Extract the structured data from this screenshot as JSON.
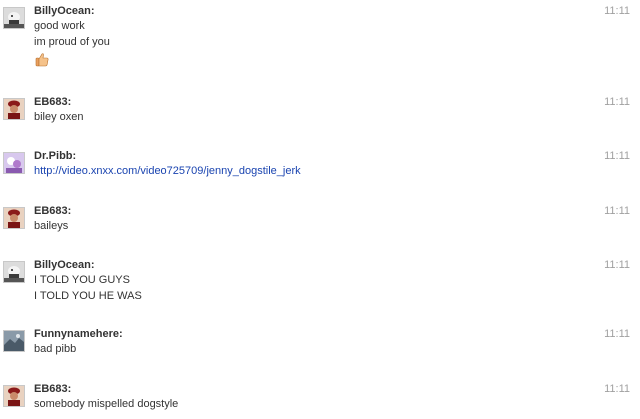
{
  "messages": [
    {
      "sender": "BillyOcean:",
      "time": "11:11",
      "avatar": "billyocean-avatar",
      "lines": [
        "good work",
        "im proud of you"
      ],
      "emoticon": "thumbs-up-icon"
    },
    {
      "sender": "EB683:",
      "time": "11:11",
      "avatar": "eb683-avatar",
      "lines": [
        "biley oxen"
      ]
    },
    {
      "sender": "Dr.Pibb:",
      "time": "11:11",
      "avatar": "drpibb-avatar",
      "lines": [
        "http://video.xnxx.com/video725709/jenny_dogstile_jerk"
      ],
      "link": true
    },
    {
      "sender": "EB683:",
      "time": "11:11",
      "avatar": "eb683-avatar",
      "lines": [
        "baileys"
      ]
    },
    {
      "sender": "BillyOcean:",
      "time": "11:11",
      "avatar": "billyocean-avatar",
      "lines": [
        "I TOLD YOU GUYS",
        "I TOLD YOU HE WAS"
      ]
    },
    {
      "sender": "Funnynamehere:",
      "time": "11:11",
      "avatar": "funnynamehere-avatar",
      "lines": [
        "bad pibb"
      ]
    },
    {
      "sender": "EB683:",
      "time": "11:11",
      "avatar": "eb683-avatar",
      "lines": [
        "somebody mispelled dogstyle"
      ]
    }
  ],
  "colors": {
    "text": "#333333",
    "timestamp": "#a0a0a0",
    "link": "#1a44b0"
  }
}
